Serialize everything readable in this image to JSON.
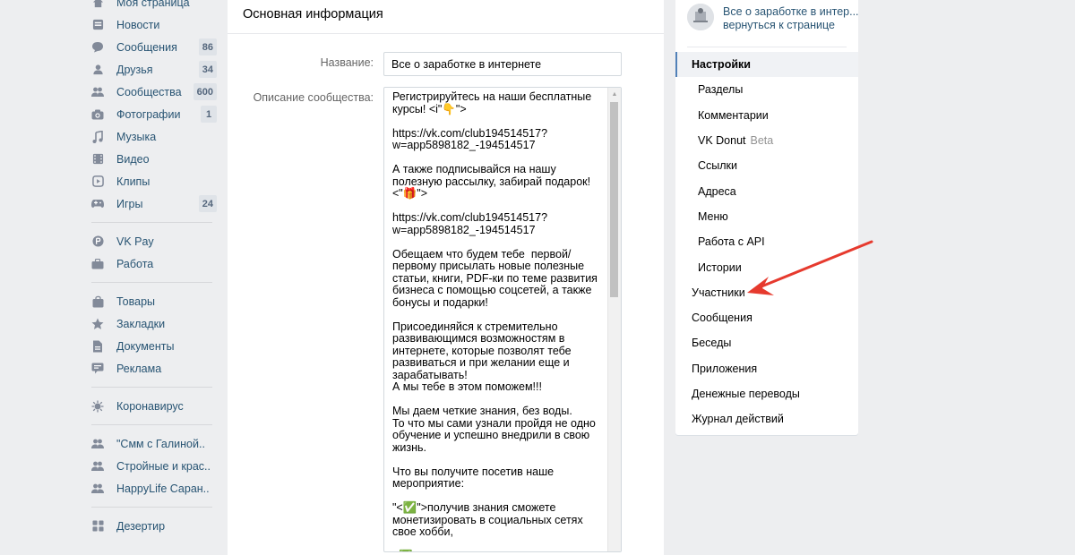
{
  "left_nav": {
    "main_items": [
      {
        "icon": "home-icon",
        "label": "Моя страница",
        "count": ""
      },
      {
        "icon": "news-icon",
        "label": "Новости",
        "count": ""
      },
      {
        "icon": "messages-icon",
        "label": "Сообщения",
        "count": "86"
      },
      {
        "icon": "friends-icon",
        "label": "Друзья",
        "count": "34"
      },
      {
        "icon": "communities-icon",
        "label": "Сообщества",
        "count": "600"
      },
      {
        "icon": "camera-icon",
        "label": "Фотографии",
        "count": "1"
      },
      {
        "icon": "music-icon",
        "label": "Музыка",
        "count": ""
      },
      {
        "icon": "video-icon",
        "label": "Видео",
        "count": ""
      },
      {
        "icon": "clips-icon",
        "label": "Клипы",
        "count": ""
      },
      {
        "icon": "gamepad-icon",
        "label": "Игры",
        "count": "24"
      }
    ],
    "pay_items": [
      {
        "icon": "vkpay-icon",
        "label": "VK Pay"
      },
      {
        "icon": "briefcase-icon",
        "label": "Работа"
      }
    ],
    "extra_items": [
      {
        "icon": "shopping-bag-icon",
        "label": "Товары"
      },
      {
        "icon": "star-icon",
        "label": "Закладки"
      },
      {
        "icon": "document-icon",
        "label": "Документы"
      },
      {
        "icon": "megaphone-icon",
        "label": "Реклама"
      }
    ],
    "virus_item": {
      "icon": "virus-icon",
      "label": "Коронавирус"
    },
    "groups": [
      {
        "icon": "group-icon",
        "label": "\"Смм с Галиной.."
      },
      {
        "icon": "group-icon",
        "label": "Стройные и крас.."
      },
      {
        "icon": "group-icon",
        "label": "HappyLife Саран.."
      }
    ],
    "apps": [
      {
        "icon": "apps-icon",
        "label": "Дезертир"
      }
    ]
  },
  "main": {
    "section_title": "Основная информация",
    "name_label": "Название:",
    "name_value": "Все о заработке в интернете",
    "desc_label": "Описание сообщества:",
    "description": "Регистрируйтесь на наши бесплатные курсы! <i\"👇\">\n\nhttps://vk.com/club194514517?w=app5898182_-194514517\n\nА также подписывайся на нашу полезную рассылку, забирай подарок!<\"🎁\">\n\nhttps://vk.com/club194514517?w=app5898182_-194514517\n\nОбещаем что будем тебе  первой/первому присылать новые полезные статьи, книги, PDF-ки по теме развития бизнеса с помощью соцсетей, а также бонусы и подарки!\n\nПрисоединяйся к стремительно развивающимся возможностям в интернете, которые позволят тебе развиваться и при желании еще и зарабатывать!\nА мы тебе в этом поможем!!!\n\nМы даем четкие знания, без воды.\nТо что мы сами узнали пройдя не одно обучение и успешно внедрили в свою жизнь.\n\nЧто вы получите посетив наше мероприятие:\n\n\"<✅\">получив знания сможете монетизировать в социальных сетях свое хобби,\n\n<✅"
  },
  "right_menu": {
    "group_title": "Все о заработке в интер...",
    "back_link": "вернуться к странице",
    "active_item": "Настройки",
    "sub_items": [
      "Разделы",
      "Комментарии",
      "VK Donut",
      "Ссылки",
      "Адреса",
      "Меню",
      "Работа с API",
      "Истории"
    ],
    "beta_label": "Beta",
    "items": [
      "Участники",
      "Сообщения",
      "Беседы",
      "Приложения",
      "Денежные переводы",
      "Журнал действий"
    ]
  },
  "colors": {
    "link": "#285473",
    "accent": "#5181b8",
    "arrow": "#e63a2e",
    "background": "#edeef0"
  }
}
